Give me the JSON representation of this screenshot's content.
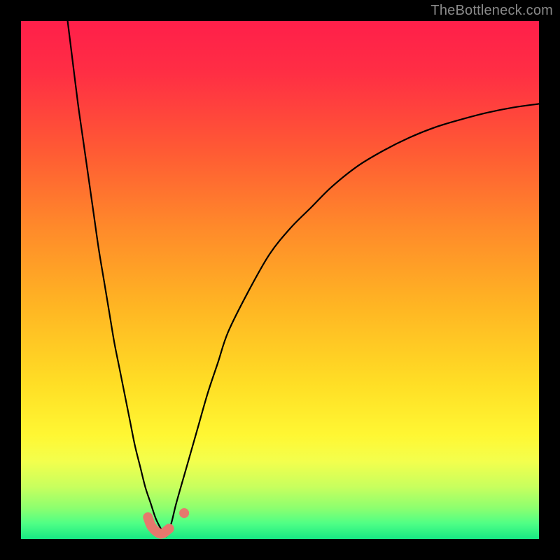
{
  "watermark": "TheBottleneck.com",
  "colors": {
    "frame": "#000000",
    "gradient_stops": [
      {
        "offset": 0.0,
        "color": "#ff1f4a"
      },
      {
        "offset": 0.1,
        "color": "#ff2e44"
      },
      {
        "offset": 0.25,
        "color": "#ff5a34"
      },
      {
        "offset": 0.4,
        "color": "#ff8a2a"
      },
      {
        "offset": 0.55,
        "color": "#ffb523"
      },
      {
        "offset": 0.7,
        "color": "#ffde25"
      },
      {
        "offset": 0.8,
        "color": "#fff733"
      },
      {
        "offset": 0.85,
        "color": "#f3ff4d"
      },
      {
        "offset": 0.9,
        "color": "#c7ff5e"
      },
      {
        "offset": 0.94,
        "color": "#8dff6f"
      },
      {
        "offset": 0.97,
        "color": "#4fff85"
      },
      {
        "offset": 1.0,
        "color": "#17e884"
      }
    ],
    "curve": "#000000",
    "marker_fill": "#e6786d",
    "marker_stroke": "#d65f55"
  },
  "chart_data": {
    "type": "line",
    "title": "",
    "xlabel": "",
    "ylabel": "",
    "xlim": [
      0,
      100
    ],
    "ylim": [
      0,
      100
    ],
    "note": "x and y are proportional axes (0–100). y=0 is bottom (green), y=100 is top (red). Two curves descend to a common minimum near x≈27, y≈0, then the second rises asymptotically.",
    "series": [
      {
        "name": "left-curve",
        "x": [
          9,
          10,
          11,
          12,
          13,
          14,
          15,
          16,
          17,
          18,
          19,
          20,
          21,
          22,
          23,
          24,
          25,
          26,
          27,
          28
        ],
        "y": [
          100,
          92,
          84,
          77,
          70,
          63,
          56,
          50,
          44,
          38,
          33,
          28,
          23,
          18,
          14,
          10,
          7,
          4,
          2,
          0.5
        ]
      },
      {
        "name": "right-curve",
        "x": [
          28,
          29,
          30,
          32,
          34,
          36,
          38,
          40,
          44,
          48,
          52,
          56,
          60,
          65,
          70,
          75,
          80,
          85,
          90,
          95,
          100
        ],
        "y": [
          0.5,
          3,
          7,
          14,
          21,
          28,
          34,
          40,
          48,
          55,
          60,
          64,
          68,
          72,
          75,
          77.5,
          79.5,
          81,
          82.3,
          83.3,
          84
        ]
      }
    ],
    "markers": [
      {
        "name": "left-sweep-start",
        "x": 24.5,
        "y": 4.2
      },
      {
        "name": "left-sweep-mid",
        "x": 25.3,
        "y": 2.3
      },
      {
        "name": "left-sweep-min",
        "x": 27.0,
        "y": 1.0
      },
      {
        "name": "left-sweep-end",
        "x": 28.6,
        "y": 2.0
      },
      {
        "name": "right-dot",
        "x": 31.5,
        "y": 5.0
      }
    ]
  }
}
